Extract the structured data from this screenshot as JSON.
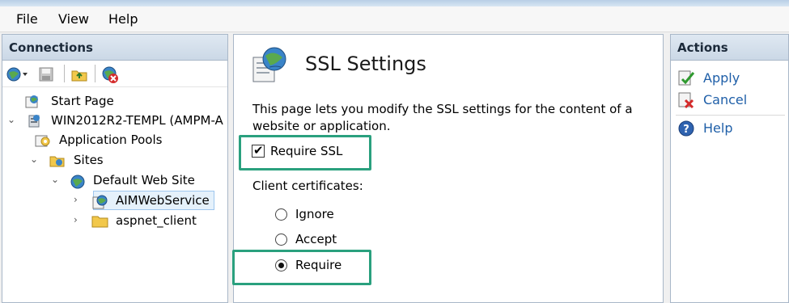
{
  "menu": {
    "file": "File",
    "view": "View",
    "help": "Help"
  },
  "connections": {
    "header": "Connections",
    "toolbar": [
      "globe-dropdown-icon",
      "save-icon",
      "up-folder-icon",
      "disconnect-icon"
    ],
    "tree": {
      "start_page": "Start Page",
      "server": "WIN2012R2-TEMPL (AMPM-A",
      "app_pools": "Application Pools",
      "sites": "Sites",
      "default_site": "Default Web Site",
      "aim_service": "AIMWebService",
      "aspnet_client": "aspnet_client"
    }
  },
  "ssl": {
    "title": "SSL Settings",
    "description": "This page lets you modify the SSL settings for the content of a website or application.",
    "require_ssl_label": "Require SSL",
    "require_ssl_checked": true,
    "client_certs_label": "Client certificates:",
    "options": {
      "ignore": "Ignore",
      "accept": "Accept",
      "require": "Require"
    },
    "selected_option": "Require",
    "highlight_color": "#2aa07e"
  },
  "actions": {
    "header": "Actions",
    "apply": "Apply",
    "cancel": "Cancel",
    "help": "Help"
  }
}
